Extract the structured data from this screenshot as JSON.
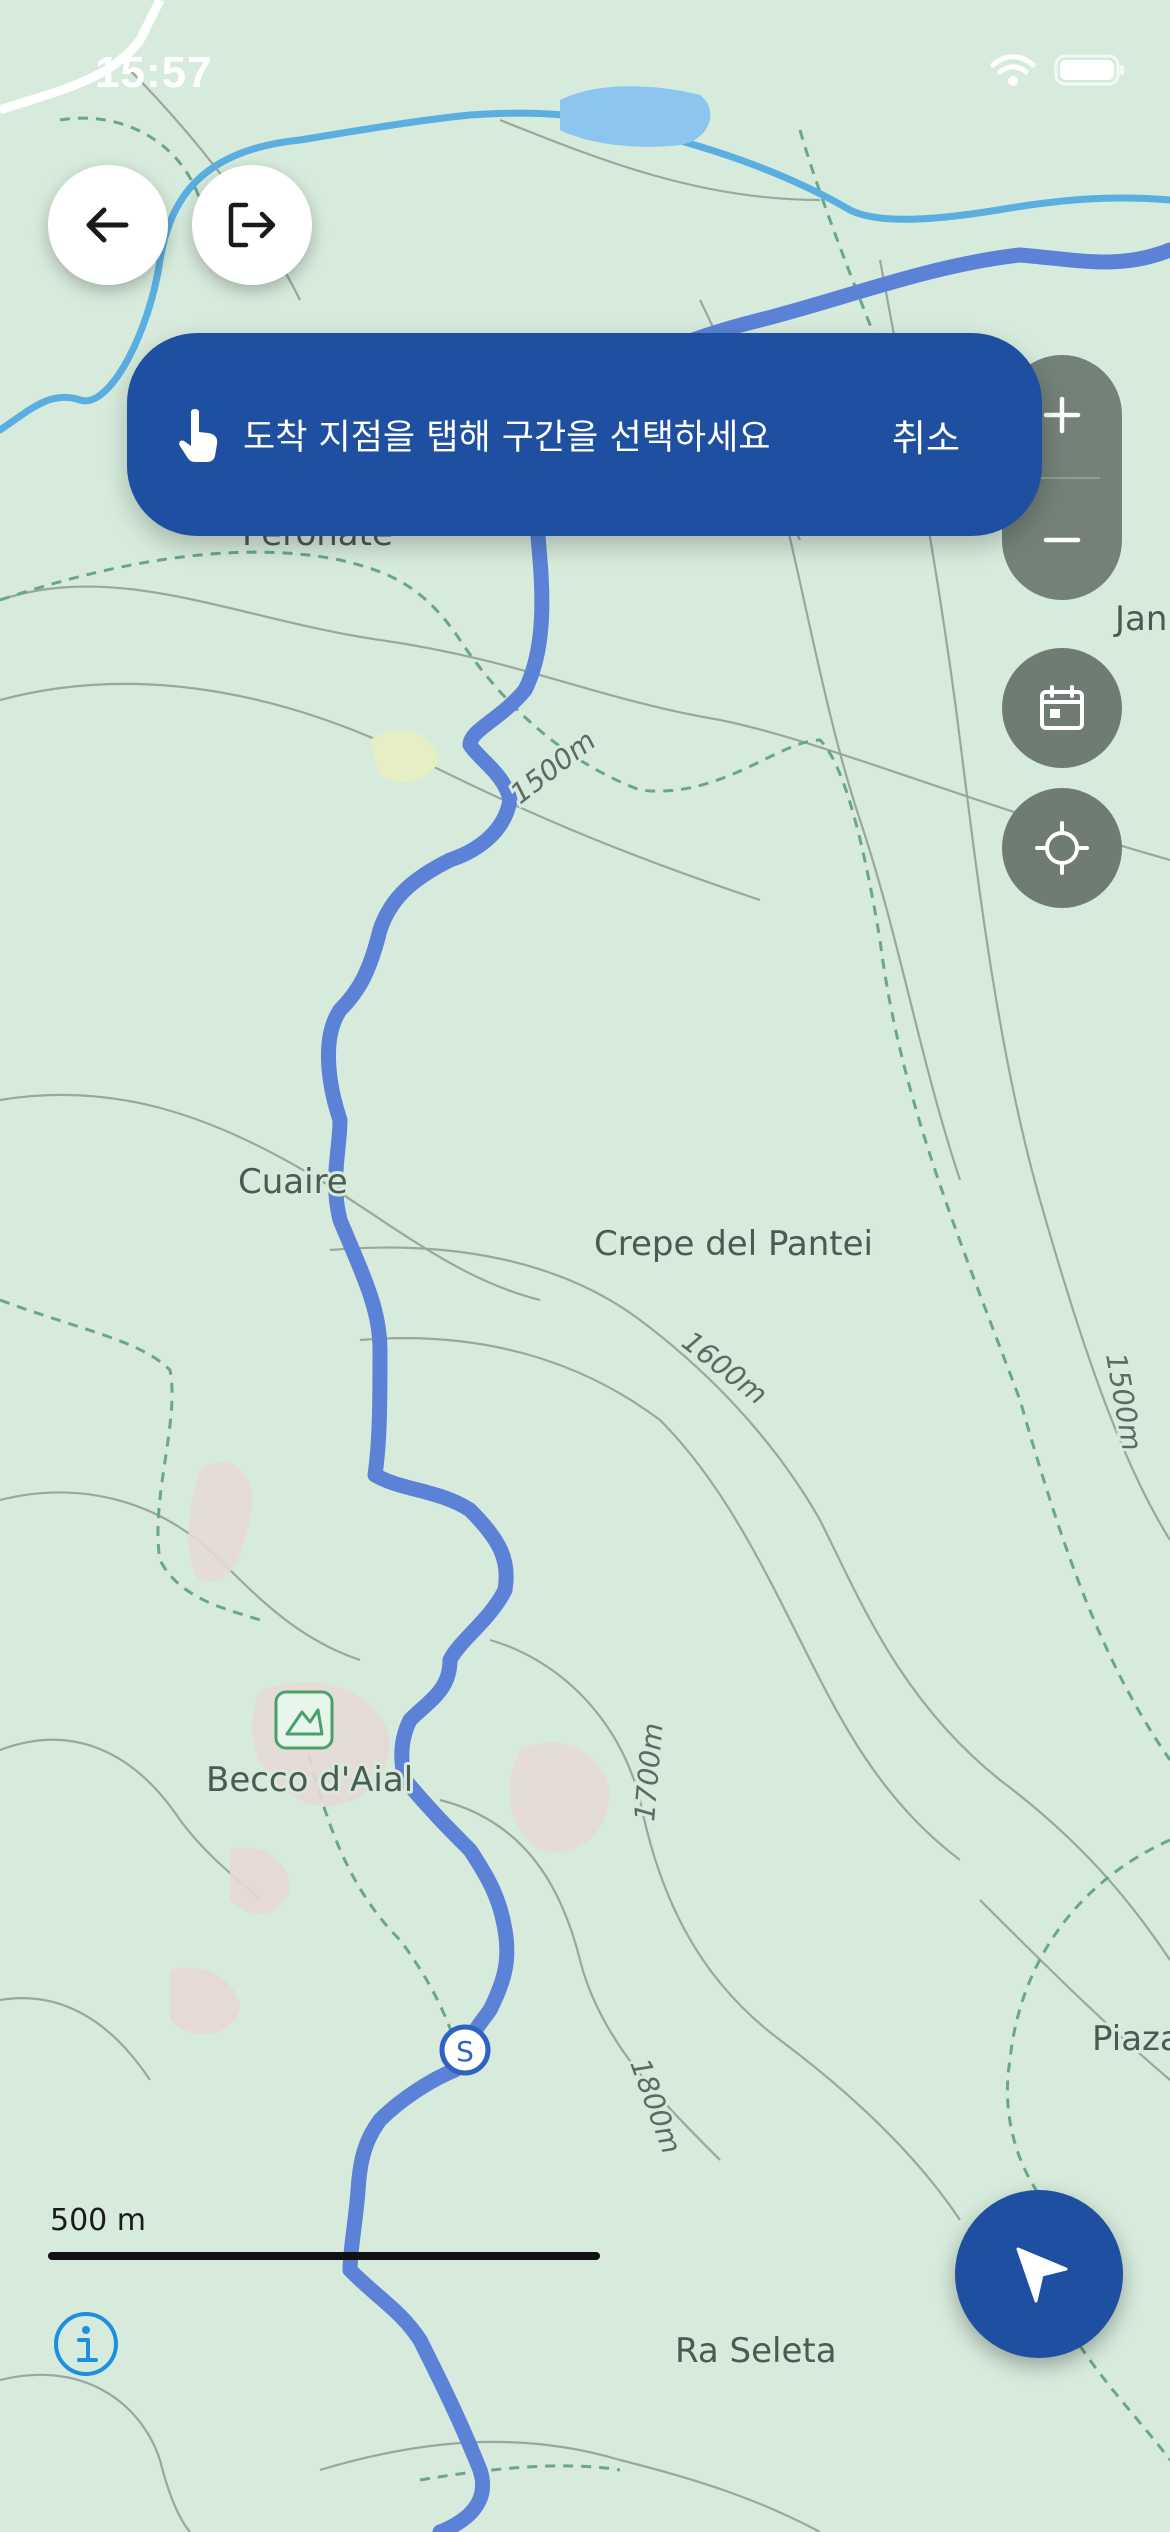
{
  "status_bar": {
    "time": "15:57"
  },
  "map": {
    "place_labels": [
      {
        "key": "peronate",
        "text": "Peronate"
      },
      {
        "key": "cuaire",
        "text": "Cuaire"
      },
      {
        "key": "crepe",
        "text": "Crepe del Pantei"
      },
      {
        "key": "becco",
        "text": "Becco d'Aial"
      },
      {
        "key": "piaza",
        "text": "Piaza"
      },
      {
        "key": "ra-seleta",
        "text": "Ra Seleta"
      },
      {
        "key": "jan",
        "text": "Jan"
      }
    ],
    "contour_labels": [
      {
        "key": "c1500a",
        "text": "1500m"
      },
      {
        "key": "c1600",
        "text": "1600m"
      },
      {
        "key": "c1500b",
        "text": "1500m"
      },
      {
        "key": "c1700",
        "text": "1700m"
      },
      {
        "key": "c1800",
        "text": "1800m"
      }
    ],
    "start_marker": "S",
    "scale_label": "500 m",
    "colors": {
      "route": "#5b82d6",
      "river": "#5aaee0",
      "background": "#d6ebdc",
      "trail": "#6aa784"
    }
  },
  "controls": {
    "back_icon": "arrow-left-icon",
    "exit_icon": "logout-icon",
    "zoom_in_icon": "plus-icon",
    "zoom_out_icon": "minus-icon",
    "calendar_icon": "calendar-icon",
    "locate_icon": "crosshair-icon",
    "info_icon": "info-icon",
    "navigate_icon": "navigation-arrow-icon"
  },
  "banner": {
    "icon": "tap-finger-icon",
    "message": "도착 지점을 탭해 구간을 선택하세요",
    "cancel_label": "취소",
    "background": "#1f4fa0"
  }
}
